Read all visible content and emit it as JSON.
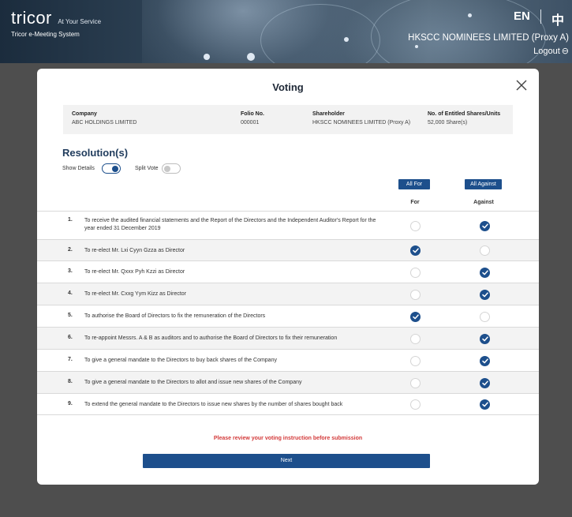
{
  "header": {
    "logo_word": "tricor",
    "logo_tagline": "At Your Service",
    "system_name": "Tricor e-Meeting System",
    "lang_en": "EN",
    "lang_zh": "中",
    "user_name": "HKSCC NOMINEES LIMITED (Proxy A)",
    "logout_label": "Logout"
  },
  "modal": {
    "title": "Voting",
    "info": {
      "company_label": "Company",
      "company_value": "ABC HOLDINGS LIMITED",
      "folio_label": "Folio No.",
      "folio_value": "000001",
      "shareholder_label": "Shareholder",
      "shareholder_value": "HKSCC NOMINEES LIMITED (Proxy A)",
      "shares_label": "No. of Entitled Shares/Units",
      "shares_value": "52,000 Share(s)"
    },
    "resolutions_title": "Resolution(s)",
    "show_details_label": "Show Details",
    "show_details_on": true,
    "split_vote_label": "Split Vote",
    "split_vote_on": false,
    "all_for_label": "All For",
    "all_against_label": "All Against",
    "for_col_label": "For",
    "against_col_label": "Against",
    "resolutions": [
      {
        "num": "1.",
        "text": "To receive the audited financial statements and the Report of the Directors and the Independent Auditor's Report for the year ended 31 December 2019",
        "vote": "against"
      },
      {
        "num": "2.",
        "text": "To re-elect Mr. Lxi Cyyn Gzza as Director",
        "vote": "for"
      },
      {
        "num": "3.",
        "text": "To re-elect Mr. Qxxx Pyh Kzzi as Director",
        "vote": "against"
      },
      {
        "num": "4.",
        "text": "To re-elect Mr. Cxxg Yym Kizz as Director",
        "vote": "against"
      },
      {
        "num": "5.",
        "text": "To authorise the Board of Directors to fix the remuneration of the Directors",
        "vote": "for"
      },
      {
        "num": "6.",
        "text": "To re-appoint Messrs. A & B as auditors and to authorise the Board of Directors to fix their remuneration",
        "vote": "against"
      },
      {
        "num": "7.",
        "text": "To give a general mandate to the Directors to buy back shares of the Company",
        "vote": "against"
      },
      {
        "num": "8.",
        "text": "To give a general mandate to the Directors to allot and issue new shares of the Company",
        "vote": "against"
      },
      {
        "num": "9.",
        "text": "To extend the general mandate to the Directors to issue new shares by the number of shares bought back",
        "vote": "against"
      }
    ],
    "warning": "Please review your voting instruction before submission",
    "next_label": "Next"
  },
  "colors": {
    "primary": "#1d4f8c",
    "warning": "#d33a3a",
    "backdrop": "#4e4e4e"
  }
}
